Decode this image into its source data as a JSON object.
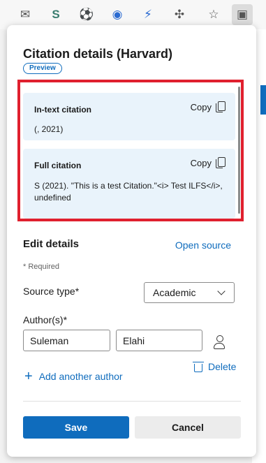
{
  "toolbar": {
    "icons": [
      "mail-icon",
      "s-extension-icon",
      "soccer-icon",
      "edge-extension-icon",
      "lightning-icon",
      "extensions-puzzle-icon",
      "favorites-star-icon",
      "collections-icon"
    ]
  },
  "panel": {
    "title": "Citation details (Harvard)",
    "badge": "Preview"
  },
  "citations": {
    "intext": {
      "label": "In-text citation",
      "text": "(, 2021)",
      "copy": "Copy"
    },
    "full": {
      "label": "Full citation",
      "text": "S (2021). \"This is a test Citation.\"<i> Test ILFS</i>, undefined",
      "copy": "Copy"
    }
  },
  "edit": {
    "title": "Edit details",
    "open_source": "Open source",
    "required": "* Required",
    "source_type_label": "Source type*",
    "source_type_value": "Academic",
    "authors_label": "Author(s)*",
    "author_first": "Suleman",
    "author_last": "Elahi",
    "delete": "Delete",
    "add_author": "Add another author"
  },
  "actions": {
    "save": "Save",
    "cancel": "Cancel"
  },
  "colors": {
    "accent": "#0f6cbd",
    "highlight": "#e0202e",
    "card": "#e9f3fb"
  }
}
